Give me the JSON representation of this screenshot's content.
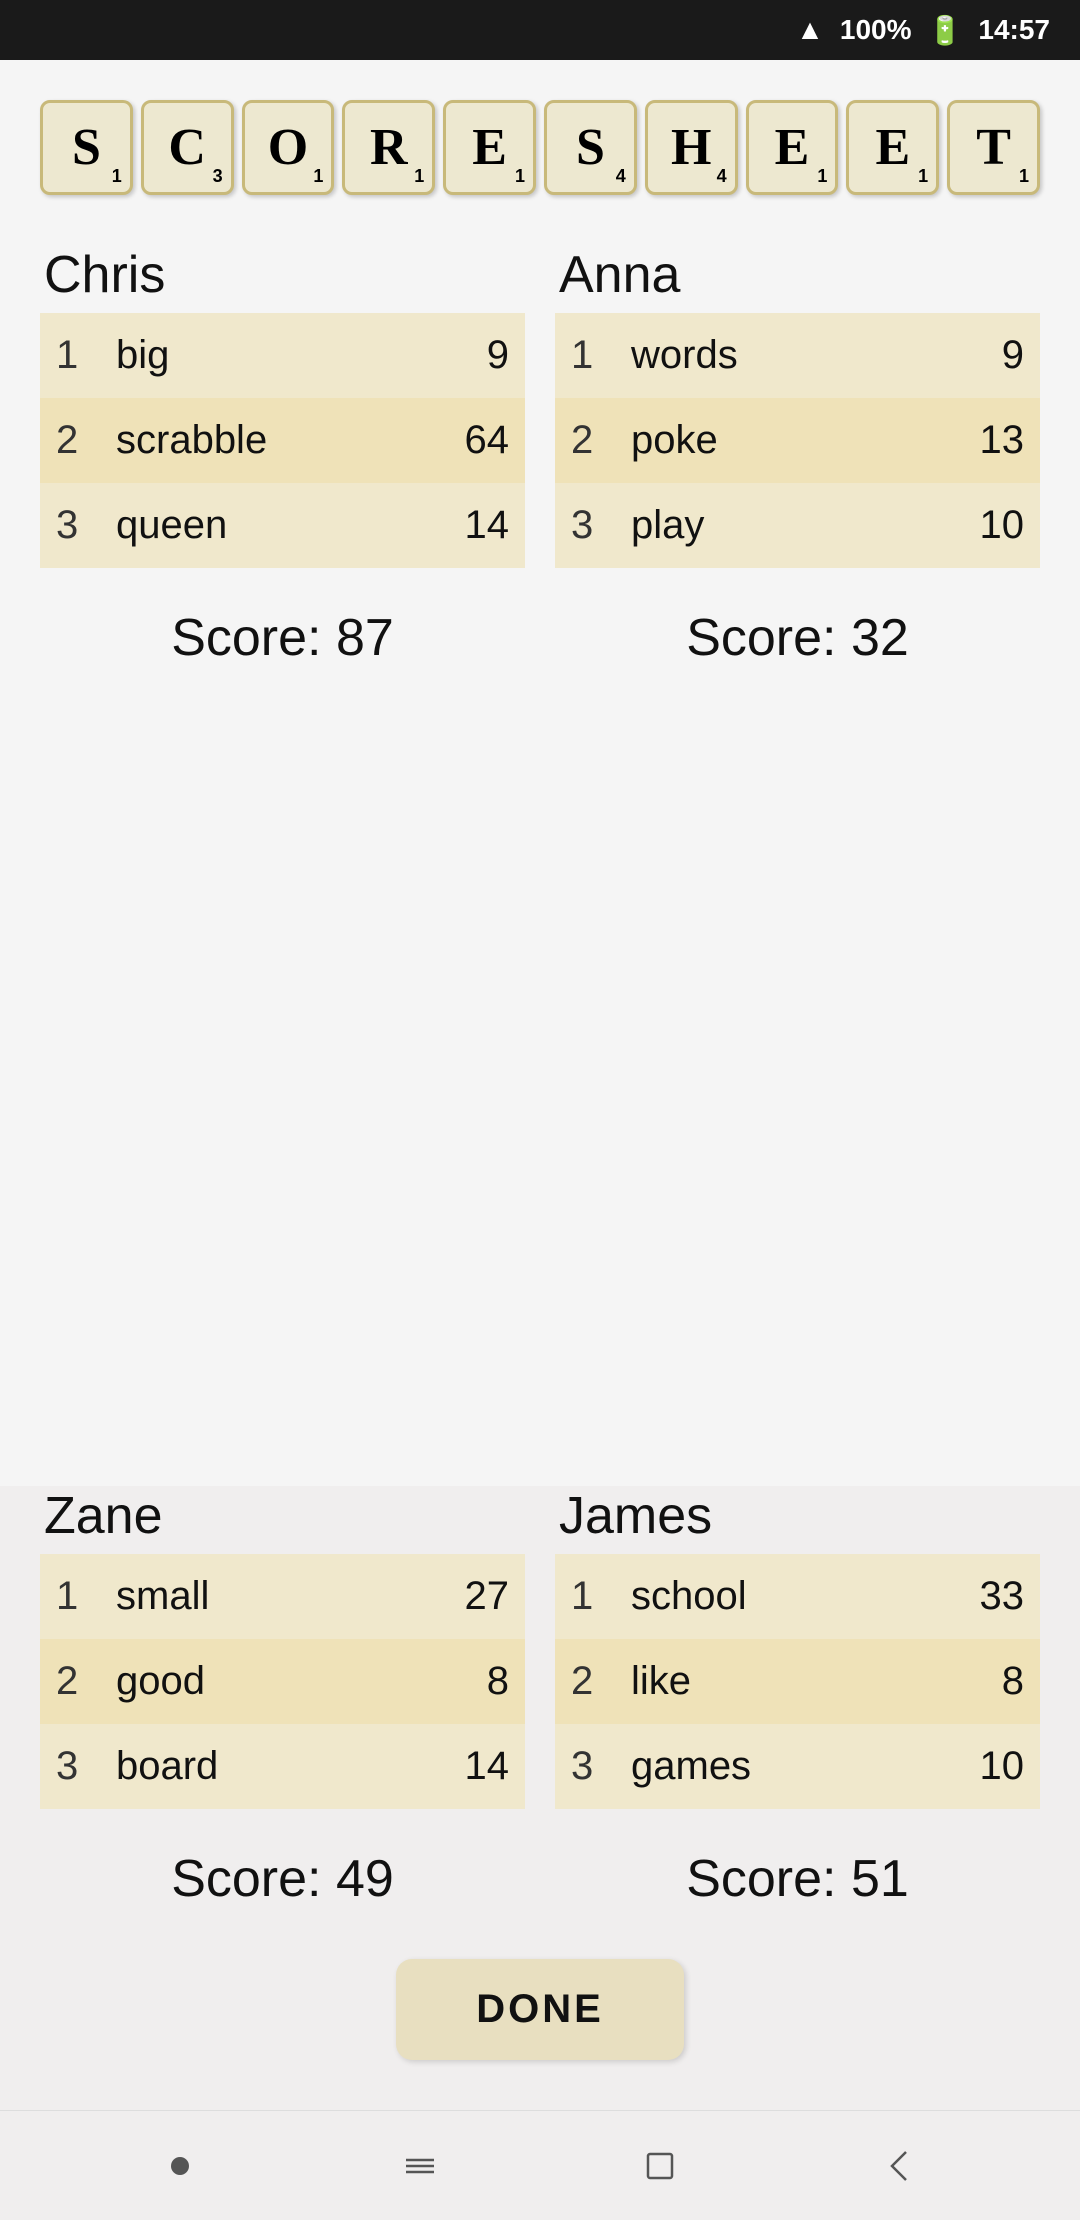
{
  "statusBar": {
    "signal": "▲",
    "battery": "100%",
    "time": "14:57"
  },
  "title": {
    "letters": [
      {
        "char": "S",
        "points": "1"
      },
      {
        "char": "C",
        "points": "3"
      },
      {
        "char": "O",
        "points": "1"
      },
      {
        "char": "R",
        "points": "1"
      },
      {
        "char": "E",
        "points": "1"
      },
      {
        "char": "S",
        "points": "4"
      },
      {
        "char": "H",
        "points": "4"
      },
      {
        "char": "E",
        "points": "1"
      },
      {
        "char": "E",
        "points": "1"
      },
      {
        "char": "T",
        "points": "1"
      }
    ]
  },
  "players": [
    {
      "name": "Chris",
      "plays": [
        {
          "turn": "1",
          "word": "big",
          "score": "9"
        },
        {
          "turn": "2",
          "word": "scrabble",
          "score": "64"
        },
        {
          "turn": "3",
          "word": "queen",
          "score": "14"
        }
      ],
      "total": "Score: 87"
    },
    {
      "name": "Anna",
      "plays": [
        {
          "turn": "1",
          "word": "words",
          "score": "9"
        },
        {
          "turn": "2",
          "word": "poke",
          "score": "13"
        },
        {
          "turn": "3",
          "word": "play",
          "score": "10"
        }
      ],
      "total": "Score: 32"
    },
    {
      "name": "Zane",
      "plays": [
        {
          "turn": "1",
          "word": "small",
          "score": "27"
        },
        {
          "turn": "2",
          "word": "good",
          "score": "8"
        },
        {
          "turn": "3",
          "word": "board",
          "score": "14"
        }
      ],
      "total": "Score: 49"
    },
    {
      "name": "James",
      "plays": [
        {
          "turn": "1",
          "word": "school",
          "score": "33"
        },
        {
          "turn": "2",
          "word": "like",
          "score": "8"
        },
        {
          "turn": "3",
          "word": "games",
          "score": "10"
        }
      ],
      "total": "Score: 51"
    }
  ],
  "doneButton": "DONE",
  "nav": {
    "dot": "●",
    "tabs": "⇌",
    "square": "□",
    "back": "←"
  }
}
